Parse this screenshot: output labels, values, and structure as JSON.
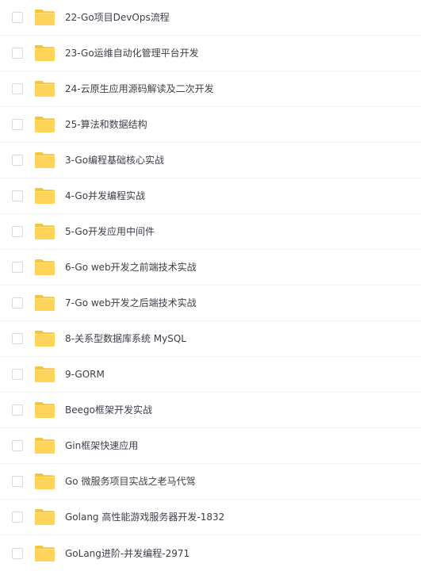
{
  "folder_color": "#FFD45A",
  "folder_tab_color": "#F8C43C",
  "checkbox_border": "#D8DBE2",
  "items": [
    {
      "label": "22-Go项目DevOps流程",
      "icon": "folder-icon"
    },
    {
      "label": "23-Go运维自动化管理平台开发",
      "icon": "folder-icon"
    },
    {
      "label": "24-云原生应用源码解读及二次开发",
      "icon": "folder-icon"
    },
    {
      "label": "25-算法和数据结构",
      "icon": "folder-icon"
    },
    {
      "label": "3-Go编程基础核心实战",
      "icon": "folder-icon"
    },
    {
      "label": "4-Go并发编程实战",
      "icon": "folder-icon"
    },
    {
      "label": "5-Go开发应用中间件",
      "icon": "folder-icon"
    },
    {
      "label": "6-Go web开发之前端技术实战",
      "icon": "folder-icon"
    },
    {
      "label": "7-Go web开发之后端技术实战",
      "icon": "folder-icon"
    },
    {
      "label": "8-关系型数据库系统 MySQL",
      "icon": "folder-icon"
    },
    {
      "label": "9-GORM",
      "icon": "folder-icon"
    },
    {
      "label": "Beego框架开发实战",
      "icon": "folder-icon"
    },
    {
      "label": "Gin框架快速应用",
      "icon": "folder-icon"
    },
    {
      "label": "Go 微服务项目实战之老马代驾",
      "icon": "folder-icon"
    },
    {
      "label": "Golang 高性能游戏服务器开发-1832",
      "icon": "folder-icon"
    },
    {
      "label": "GoLang进阶-并发编程-2971",
      "icon": "folder-icon"
    }
  ]
}
